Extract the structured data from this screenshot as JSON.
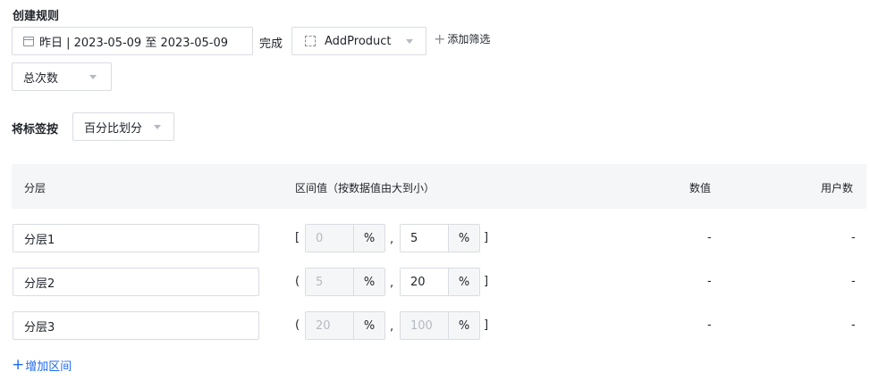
{
  "header": {
    "title": "创建规则"
  },
  "filters": {
    "date_range": "昨日 | 2023-05-09 至 2023-05-09",
    "done_label": "完成",
    "event": "AddProduct",
    "add_filter_label": "添加筛选",
    "metric": "总次数"
  },
  "labeling": {
    "label_by": "将标签按",
    "mode": "百分比划分"
  },
  "table": {
    "headers": {
      "tier": "分层",
      "interval": "区间值（按数据值由大到小）",
      "value": "数值",
      "users": "用户数"
    },
    "rows": [
      {
        "name": "分层1",
        "open": "[",
        "low": "0",
        "low_unit": "%",
        "sep": ",",
        "high": "5",
        "high_unit": "%",
        "close": "]",
        "value": "-",
        "users": "-"
      },
      {
        "name": "分层2",
        "open": "(",
        "low": "5",
        "low_unit": "%",
        "sep": ",",
        "high": "20",
        "high_unit": "%",
        "close": "]",
        "value": "-",
        "users": "-"
      },
      {
        "name": "分层3",
        "open": "(",
        "low": "20",
        "low_unit": "%",
        "sep": ",",
        "high": "100",
        "high_unit": "%",
        "close": "]",
        "value": "-",
        "users": "-"
      }
    ]
  },
  "add_interval_label": "增加区间"
}
